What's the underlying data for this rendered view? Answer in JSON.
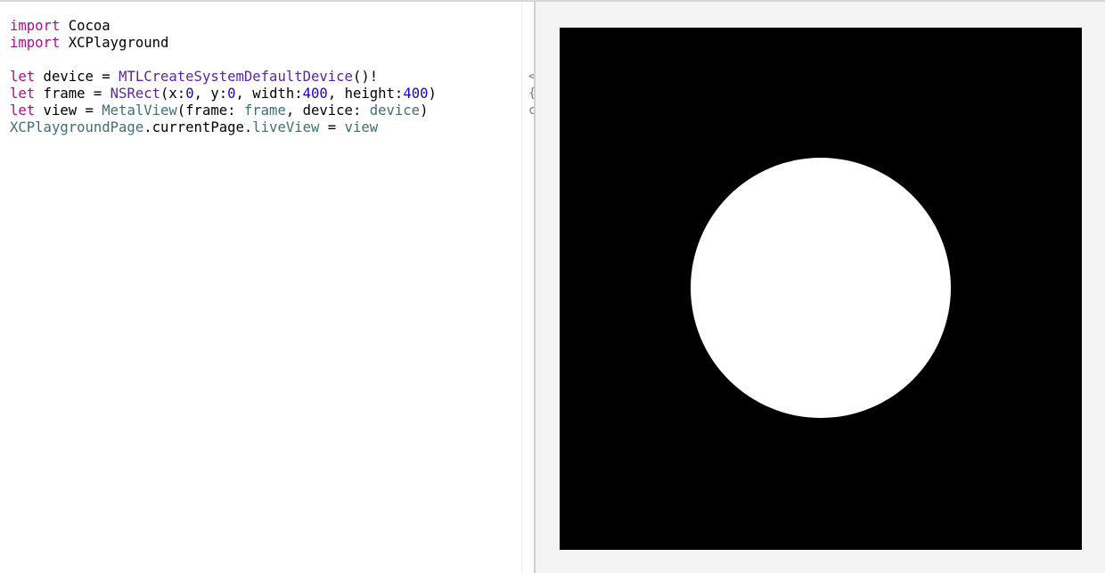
{
  "editor": {
    "lines": [
      [
        {
          "t": "import",
          "c": "kw"
        },
        {
          "t": " Cocoa",
          "c": ""
        }
      ],
      [
        {
          "t": "import",
          "c": "kw"
        },
        {
          "t": " XCPlayground",
          "c": ""
        }
      ],
      [],
      [
        {
          "t": "let",
          "c": "kw"
        },
        {
          "t": " device = ",
          "c": ""
        },
        {
          "t": "MTLCreateSystemDefaultDevice",
          "c": "type-decl"
        },
        {
          "t": "()!",
          "c": ""
        }
      ],
      [
        {
          "t": "let",
          "c": "kw"
        },
        {
          "t": " frame = ",
          "c": ""
        },
        {
          "t": "NSRect",
          "c": "type-decl"
        },
        {
          "t": "(x:",
          "c": ""
        },
        {
          "t": "0",
          "c": "num"
        },
        {
          "t": ", y:",
          "c": ""
        },
        {
          "t": "0",
          "c": "num"
        },
        {
          "t": ", width:",
          "c": ""
        },
        {
          "t": "400",
          "c": "num"
        },
        {
          "t": ", height:",
          "c": ""
        },
        {
          "t": "400",
          "c": "num"
        },
        {
          "t": ")",
          "c": ""
        }
      ],
      [
        {
          "t": "let",
          "c": "kw"
        },
        {
          "t": " view = ",
          "c": ""
        },
        {
          "t": "MetalView",
          "c": "proj"
        },
        {
          "t": "(frame: ",
          "c": ""
        },
        {
          "t": "frame",
          "c": "proj"
        },
        {
          "t": ", device: ",
          "c": ""
        },
        {
          "t": "device",
          "c": "proj"
        },
        {
          "t": ")",
          "c": ""
        }
      ],
      [
        {
          "t": "XCPlaygroundPage",
          "c": "proj"
        },
        {
          "t": ".currentPage.",
          "c": ""
        },
        {
          "t": "liveView",
          "c": "proj"
        },
        {
          "t": " = ",
          "c": ""
        },
        {
          "t": "view",
          "c": "proj"
        }
      ]
    ]
  },
  "results_gutter": {
    "items": [
      {
        "text": "<",
        "line": 3
      },
      {
        "text": "{",
        "line": 4
      },
      {
        "text": "c",
        "line": 5
      }
    ]
  },
  "live_view": {
    "background": "#000000",
    "shape": "circle",
    "shape_color": "#ffffff"
  },
  "colors": {
    "keyword": "#aa0d91",
    "number": "#1c00cf",
    "system_symbol": "#5c2699",
    "project_symbol": "#3f6e74"
  }
}
